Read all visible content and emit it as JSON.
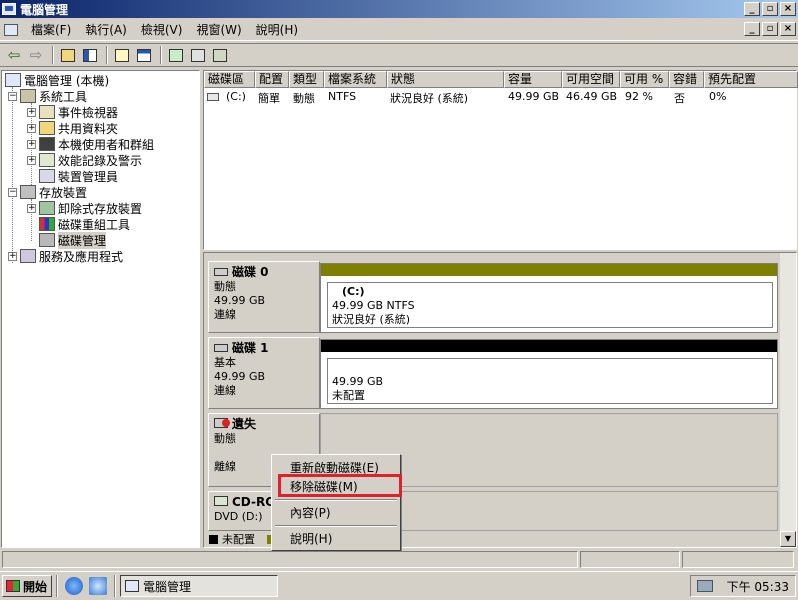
{
  "window": {
    "title": "電腦管理",
    "min_label": "_",
    "max_label": "▫",
    "close_label": "×"
  },
  "menus": [
    "檔案(F)",
    "執行(A)",
    "檢視(V)",
    "視窗(W)",
    "說明(H)"
  ],
  "toolbar": {
    "back": "⇦",
    "forward": "⇨",
    "icons": [
      "up-folder-icon",
      "show-hide-tree-icon",
      "help-icon",
      "properties-icon",
      "refresh-icon",
      "export-icon",
      "disk-icon"
    ]
  },
  "tree": {
    "items": [
      {
        "label": "電腦管理 (本機)"
      },
      {
        "label": "系統工具"
      },
      {
        "label": "事件檢視器"
      },
      {
        "label": "共用資料夾"
      },
      {
        "label": "本機使用者和群組"
      },
      {
        "label": "效能記錄及警示"
      },
      {
        "label": "裝置管理員"
      },
      {
        "label": "存放裝置"
      },
      {
        "label": "卸除式存放裝置"
      },
      {
        "label": "磁碟重組工具"
      },
      {
        "label": "磁碟管理"
      },
      {
        "label": "服務及應用程式"
      }
    ]
  },
  "volume_list": {
    "columns": [
      "磁碟區",
      "配置",
      "類型",
      "檔案系統",
      "狀態",
      "容量",
      "可用空間",
      "可用 %",
      "容錯",
      "預先配置"
    ],
    "rows": [
      [
        "(C:)",
        "簡單",
        "動態",
        "NTFS",
        "狀況良好 (系統)",
        "49.99 GB",
        "46.49 GB",
        "92 %",
        "否",
        "0%"
      ]
    ]
  },
  "disks": [
    {
      "name": "磁碟 0",
      "type": "動態",
      "size": "49.99 GB",
      "status": "連線",
      "vol_title": "(C:)",
      "vol_line1": "49.99 GB NTFS",
      "vol_line2": "狀況良好 (系統)",
      "bar_color": "#808000"
    },
    {
      "name": "磁碟 1",
      "type": "基本",
      "size": "49.99 GB",
      "status": "連線",
      "vol_line1": "49.99 GB",
      "vol_line2": "未配置",
      "bar_color": "#000000"
    },
    {
      "name": "遺失",
      "type": "動態",
      "status": "離線"
    },
    {
      "name": "CD-ROM 0",
      "type": "DVD (D:)"
    }
  ],
  "legend": {
    "unallocated": "未配置"
  },
  "context_menu": {
    "items": [
      "重新啟動磁碟(E)",
      "移除磁碟(M)",
      "內容(P)",
      "說明(H)"
    ]
  },
  "taskbar": {
    "start": "開始",
    "task": "電腦管理",
    "clock": "下午 05:33"
  }
}
